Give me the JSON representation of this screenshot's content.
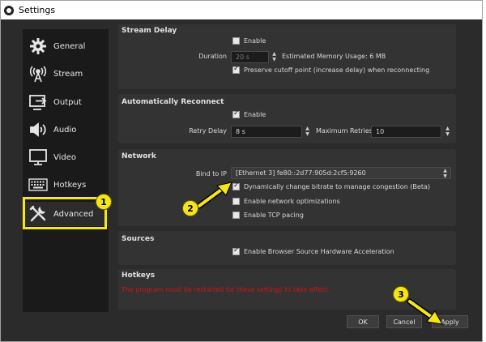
{
  "window": {
    "title": "Settings"
  },
  "sidebar": {
    "items": [
      {
        "label": "General",
        "icon": "gear-icon"
      },
      {
        "label": "Stream",
        "icon": "broadcast-icon"
      },
      {
        "label": "Output",
        "icon": "output-icon"
      },
      {
        "label": "Audio",
        "icon": "speaker-icon"
      },
      {
        "label": "Video",
        "icon": "monitor-icon"
      },
      {
        "label": "Hotkeys",
        "icon": "keyboard-icon"
      },
      {
        "label": "Advanced",
        "icon": "tools-icon"
      }
    ],
    "active": "Advanced"
  },
  "stream_delay": {
    "title": "Stream Delay",
    "enable_label": "Enable",
    "enable_checked": false,
    "duration_label": "Duration",
    "duration_value": "20 s",
    "memory_text": "Estimated Memory Usage: 6 MB",
    "preserve_label": "Preserve cutoff point (increase delay) when reconnecting",
    "preserve_checked": true
  },
  "auto_reconnect": {
    "title": "Automatically Reconnect",
    "enable_label": "Enable",
    "enable_checked": true,
    "retry_delay_label": "Retry Delay",
    "retry_delay_value": "8 s",
    "max_retries_label": "Maximum Retries",
    "max_retries_value": "10"
  },
  "network": {
    "title": "Network",
    "bind_label": "Bind to IP",
    "bind_value": "[Ethernet 3] fe80::2d77:905d:2cf5:9260",
    "dynamic_bitrate_label": "Dynamically change bitrate to manage congestion (Beta)",
    "dynamic_bitrate_checked": true,
    "network_opt_label": "Enable network optimizations",
    "network_opt_checked": false,
    "tcp_pacing_label": "Enable TCP pacing",
    "tcp_pacing_checked": false
  },
  "sources": {
    "title": "Sources",
    "browser_accel_label": "Enable Browser Source Hardware Acceleration",
    "browser_accel_checked": true
  },
  "hotkeys": {
    "title": "Hotkeys"
  },
  "warning_text": "The program must be restarted for these settings to take effect.",
  "buttons": {
    "ok": "OK",
    "cancel": "Cancel",
    "apply": "Apply"
  },
  "annotations": {
    "badge1": "1",
    "badge2": "2",
    "badge3": "3",
    "color": "#f5e51d"
  }
}
